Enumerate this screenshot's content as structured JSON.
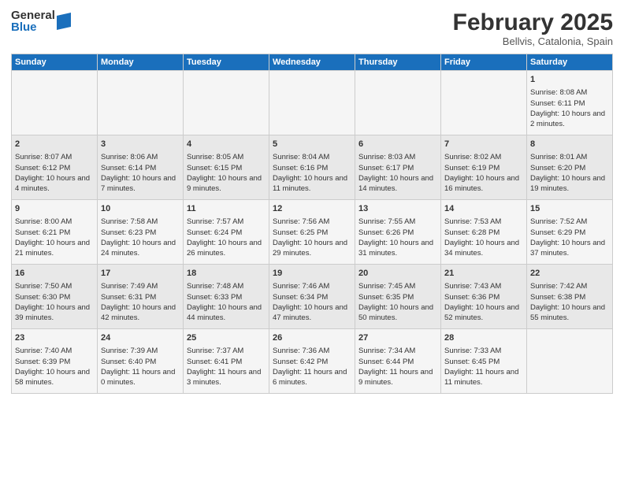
{
  "logo": {
    "general": "General",
    "blue": "Blue"
  },
  "header": {
    "month": "February 2025",
    "location": "Bellvis, Catalonia, Spain"
  },
  "days_of_week": [
    "Sunday",
    "Monday",
    "Tuesday",
    "Wednesday",
    "Thursday",
    "Friday",
    "Saturday"
  ],
  "weeks": [
    [
      {
        "day": "",
        "info": ""
      },
      {
        "day": "",
        "info": ""
      },
      {
        "day": "",
        "info": ""
      },
      {
        "day": "",
        "info": ""
      },
      {
        "day": "",
        "info": ""
      },
      {
        "day": "",
        "info": ""
      },
      {
        "day": "1",
        "info": "Sunrise: 8:08 AM\nSunset: 6:11 PM\nDaylight: 10 hours and 2 minutes."
      }
    ],
    [
      {
        "day": "2",
        "info": "Sunrise: 8:07 AM\nSunset: 6:12 PM\nDaylight: 10 hours and 4 minutes."
      },
      {
        "day": "3",
        "info": "Sunrise: 8:06 AM\nSunset: 6:14 PM\nDaylight: 10 hours and 7 minutes."
      },
      {
        "day": "4",
        "info": "Sunrise: 8:05 AM\nSunset: 6:15 PM\nDaylight: 10 hours and 9 minutes."
      },
      {
        "day": "5",
        "info": "Sunrise: 8:04 AM\nSunset: 6:16 PM\nDaylight: 10 hours and 11 minutes."
      },
      {
        "day": "6",
        "info": "Sunrise: 8:03 AM\nSunset: 6:17 PM\nDaylight: 10 hours and 14 minutes."
      },
      {
        "day": "7",
        "info": "Sunrise: 8:02 AM\nSunset: 6:19 PM\nDaylight: 10 hours and 16 minutes."
      },
      {
        "day": "8",
        "info": "Sunrise: 8:01 AM\nSunset: 6:20 PM\nDaylight: 10 hours and 19 minutes."
      }
    ],
    [
      {
        "day": "9",
        "info": "Sunrise: 8:00 AM\nSunset: 6:21 PM\nDaylight: 10 hours and 21 minutes."
      },
      {
        "day": "10",
        "info": "Sunrise: 7:58 AM\nSunset: 6:23 PM\nDaylight: 10 hours and 24 minutes."
      },
      {
        "day": "11",
        "info": "Sunrise: 7:57 AM\nSunset: 6:24 PM\nDaylight: 10 hours and 26 minutes."
      },
      {
        "day": "12",
        "info": "Sunrise: 7:56 AM\nSunset: 6:25 PM\nDaylight: 10 hours and 29 minutes."
      },
      {
        "day": "13",
        "info": "Sunrise: 7:55 AM\nSunset: 6:26 PM\nDaylight: 10 hours and 31 minutes."
      },
      {
        "day": "14",
        "info": "Sunrise: 7:53 AM\nSunset: 6:28 PM\nDaylight: 10 hours and 34 minutes."
      },
      {
        "day": "15",
        "info": "Sunrise: 7:52 AM\nSunset: 6:29 PM\nDaylight: 10 hours and 37 minutes."
      }
    ],
    [
      {
        "day": "16",
        "info": "Sunrise: 7:50 AM\nSunset: 6:30 PM\nDaylight: 10 hours and 39 minutes."
      },
      {
        "day": "17",
        "info": "Sunrise: 7:49 AM\nSunset: 6:31 PM\nDaylight: 10 hours and 42 minutes."
      },
      {
        "day": "18",
        "info": "Sunrise: 7:48 AM\nSunset: 6:33 PM\nDaylight: 10 hours and 44 minutes."
      },
      {
        "day": "19",
        "info": "Sunrise: 7:46 AM\nSunset: 6:34 PM\nDaylight: 10 hours and 47 minutes."
      },
      {
        "day": "20",
        "info": "Sunrise: 7:45 AM\nSunset: 6:35 PM\nDaylight: 10 hours and 50 minutes."
      },
      {
        "day": "21",
        "info": "Sunrise: 7:43 AM\nSunset: 6:36 PM\nDaylight: 10 hours and 52 minutes."
      },
      {
        "day": "22",
        "info": "Sunrise: 7:42 AM\nSunset: 6:38 PM\nDaylight: 10 hours and 55 minutes."
      }
    ],
    [
      {
        "day": "23",
        "info": "Sunrise: 7:40 AM\nSunset: 6:39 PM\nDaylight: 10 hours and 58 minutes."
      },
      {
        "day": "24",
        "info": "Sunrise: 7:39 AM\nSunset: 6:40 PM\nDaylight: 11 hours and 0 minutes."
      },
      {
        "day": "25",
        "info": "Sunrise: 7:37 AM\nSunset: 6:41 PM\nDaylight: 11 hours and 3 minutes."
      },
      {
        "day": "26",
        "info": "Sunrise: 7:36 AM\nSunset: 6:42 PM\nDaylight: 11 hours and 6 minutes."
      },
      {
        "day": "27",
        "info": "Sunrise: 7:34 AM\nSunset: 6:44 PM\nDaylight: 11 hours and 9 minutes."
      },
      {
        "day": "28",
        "info": "Sunrise: 7:33 AM\nSunset: 6:45 PM\nDaylight: 11 hours and 11 minutes."
      },
      {
        "day": "",
        "info": ""
      }
    ]
  ]
}
